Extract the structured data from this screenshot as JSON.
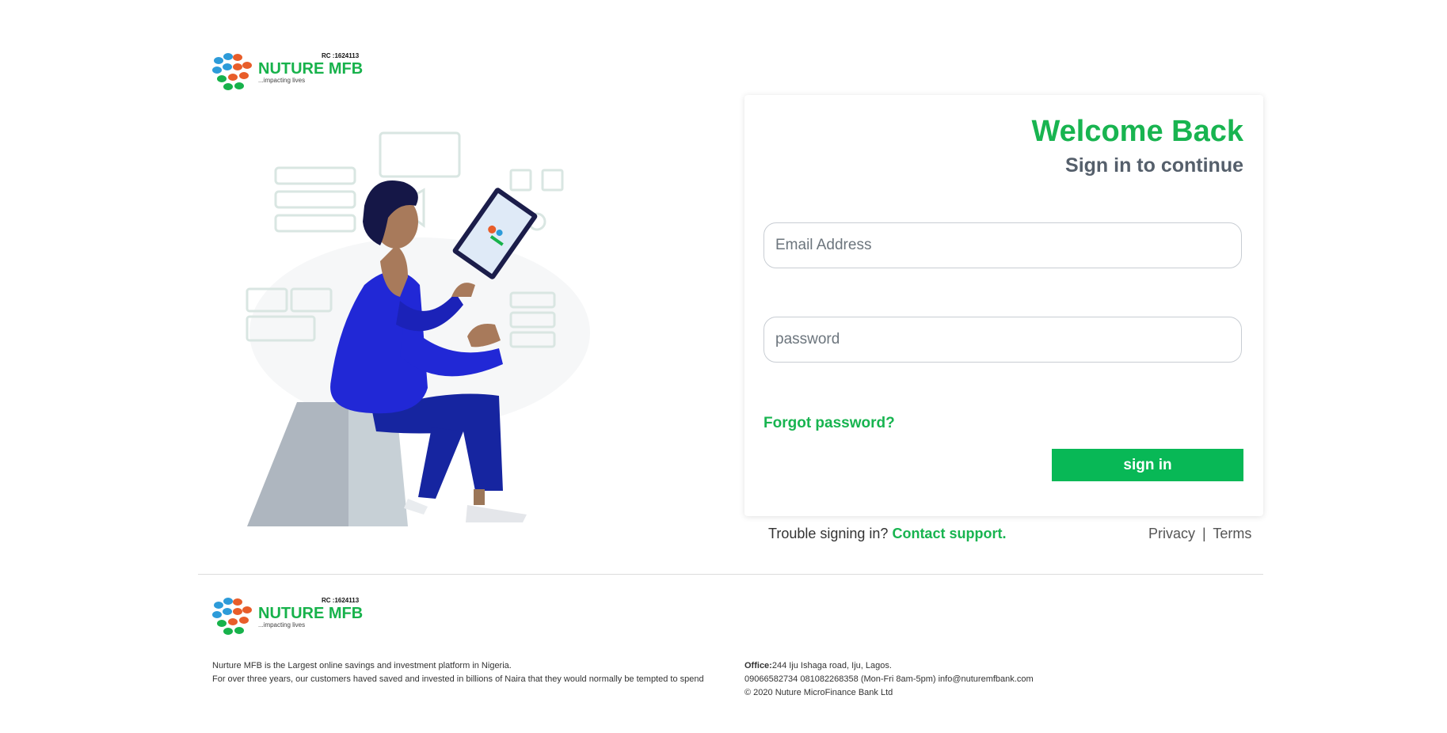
{
  "brand": {
    "name": "NUTURE MFB",
    "rc": "RC :1624113",
    "tagline": "...impacting lives",
    "colors": {
      "green": "#17b24b",
      "blue": "#2d9bd9",
      "orange": "#e85d2a"
    }
  },
  "login": {
    "title": "Welcome Back",
    "subtitle": "Sign in to continue",
    "email_placeholder": "Email Address",
    "password_placeholder": "password",
    "forgot_label": "Forgot password?",
    "signin_label": "sign in"
  },
  "support": {
    "prompt": "Trouble signing in?",
    "link_label": "Contact support.",
    "privacy_label": "Privacy",
    "separator": "|",
    "terms_label": "Terms"
  },
  "footer": {
    "description_line1": "Nurture MFB is the Largest online savings and investment platform in Nigeria.",
    "description_line2": "For over three years, our customers haved saved and invested in billions of Naira that they would normally be tempted to spend",
    "office_label": "Office:",
    "office_address": "244 Iju Ishaga road, Iju, Lagos.",
    "contact": "09066582734 081082268358 (Mon-Fri 8am-5pm) info@nuturemfbank.com",
    "copyright": "© 2020 Nuture MicroFinance Bank Ltd"
  }
}
